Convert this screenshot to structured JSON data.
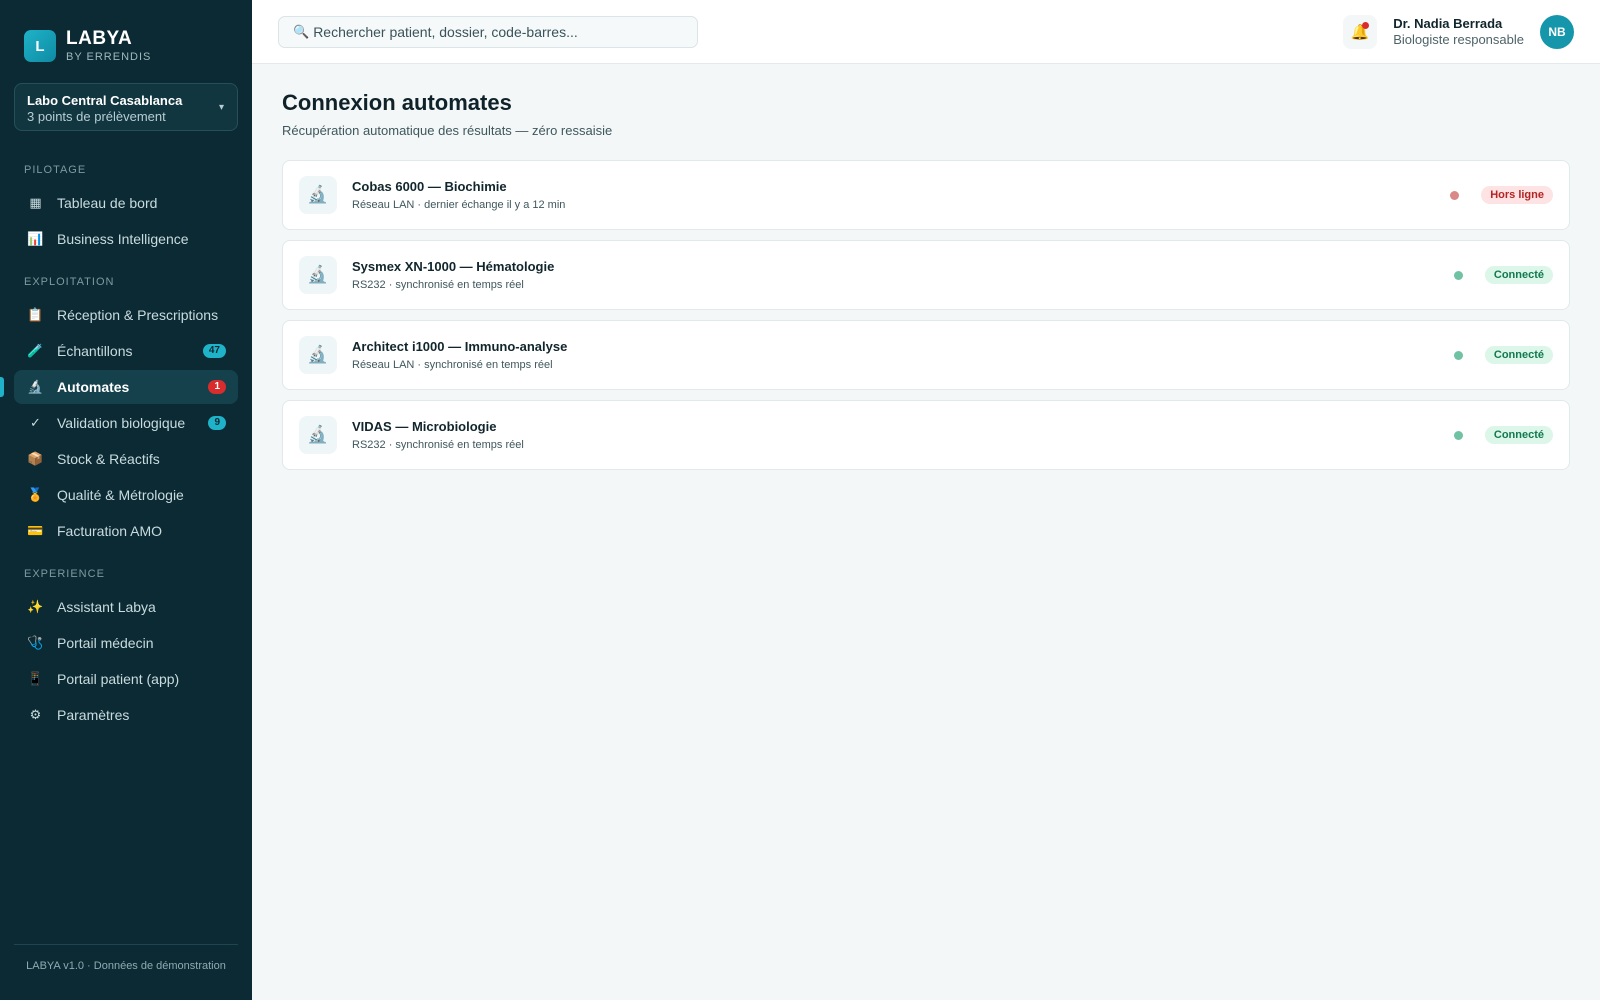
{
  "brand": {
    "logo_letter": "L",
    "name": "LABYA",
    "sub": "BY ERRENDIS"
  },
  "site": {
    "name": "Labo Central Casablanca",
    "sub": "3 points de prélèvement"
  },
  "nav": {
    "sections": {
      "pilotage": "PILOTAGE",
      "exploitation": "EXPLOITATION",
      "experience": "EXPERIENCE"
    },
    "items": [
      {
        "label": "Tableau de bord",
        "icon": "▦"
      },
      {
        "label": "Business Intelligence",
        "icon": "📊"
      },
      {
        "label": "Réception & Prescriptions",
        "icon": "📋"
      },
      {
        "label": "Échantillons",
        "icon": "🧪",
        "badge": "47"
      },
      {
        "label": "Automates",
        "icon": "🔬",
        "badge": "1"
      },
      {
        "label": "Validation biologique",
        "icon": "✓",
        "badge": "9"
      },
      {
        "label": "Stock & Réactifs",
        "icon": "📦"
      },
      {
        "label": "Qualité & Métrologie",
        "icon": "🏅"
      },
      {
        "label": "Facturation AMO",
        "icon": "💳"
      },
      {
        "label": "Assistant Labya",
        "icon": "✨"
      },
      {
        "label": "Portail médecin",
        "icon": "🩺"
      },
      {
        "label": "Portail patient (app)",
        "icon": "📱"
      },
      {
        "label": "Paramètres",
        "icon": "⚙"
      }
    ]
  },
  "footer": "LABYA v1.0 · Données de démonstration",
  "search": {
    "placeholder": "Rechercher patient, dossier, code-barres..."
  },
  "user": {
    "name": "Dr. Nadia Berrada",
    "role": "Biologiste responsable",
    "initials": "NB"
  },
  "page": {
    "title": "Connexion automates",
    "subtitle": "Récupération automatique des résultats — zéro ressaisie"
  },
  "devices": [
    {
      "name": "Cobas 6000 — Biochimie",
      "sub": "Réseau LAN · dernier échange il y a 12 min",
      "status": "Hors ligne"
    },
    {
      "name": "Sysmex XN-1000 — Hématologie",
      "sub": "RS232 · synchronisé en temps réel",
      "status": "Connecté"
    },
    {
      "name": "Architect i1000 — Immuno-analyse",
      "sub": "Réseau LAN · synchronisé en temps réel",
      "status": "Connecté"
    },
    {
      "name": "VIDAS — Microbiologie",
      "sub": "RS232 · synchronisé en temps réel",
      "status": "Connecté"
    }
  ],
  "colors": {
    "sidebar_bg": "#0c2a33",
    "accent": "#1fb3c9",
    "offline": "#b32424",
    "online": "#137a4e"
  },
  "icons": {
    "search": "🔍",
    "bell": "🔔",
    "chevron": "▾",
    "device": "🔬"
  }
}
